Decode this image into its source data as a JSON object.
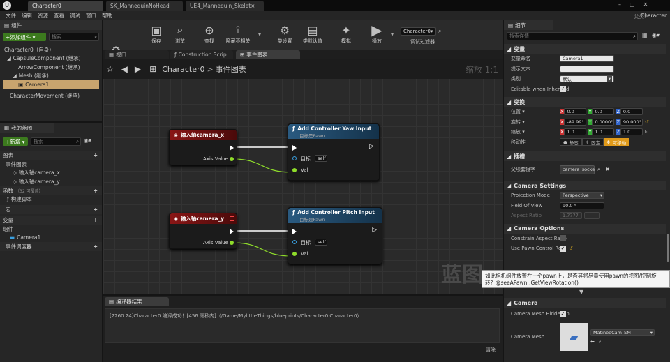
{
  "titlebar": {
    "tabs": [
      "Character0",
      "SK_MannequinNoHead",
      "UE4_Mannequin_Skelet×"
    ],
    "parent_label": "父类:",
    "parent_value": "Character"
  },
  "menu": [
    "文件",
    "编辑",
    "资源",
    "查看",
    "调试",
    "窗口",
    "帮助"
  ],
  "components": {
    "header": "组件",
    "add_button": "+添加组件 ▾",
    "search_placeholder": "搜索",
    "items": [
      "Character0（自身）",
      "CapsuleComponent (继承)",
      "ArrowComponent (继承)",
      "Mesh (继承)",
      "Camera1",
      "CharacterMovement (继承)"
    ]
  },
  "toolbar": {
    "buttons": [
      "编译",
      "保存",
      "浏览",
      "查找",
      "隐藏不相关",
      "类设置",
      "类默认值",
      "模拟",
      "播放"
    ],
    "debug_select": "Character0▾",
    "debug_label": "调试过滤器"
  },
  "graph_tabs": [
    "视口",
    "Construction Scrip",
    "事件图表"
  ],
  "breadcrumb": {
    "root": "Character0",
    "sep": ">",
    "current": "事件图表"
  },
  "zoom": "缩放 1:1",
  "watermark": "蓝图",
  "my_blueprint": {
    "header": "我的蓝图",
    "new_button": "+新增 ▾",
    "search_placeholder": "搜索",
    "sections": {
      "graphs": "图表",
      "event_graph": "事件图表",
      "input_x": "输入轴camera_x",
      "input_y": "输入轴camera_y",
      "functions": "函数",
      "functions_note": "（32 可覆盖）",
      "construct": "构建脚本",
      "macros": "宏",
      "variables": "变量",
      "components": "组件",
      "camera": "Camera1",
      "dispatchers": "事件调度器"
    }
  },
  "nodes": {
    "input_x": {
      "title": "输入轴camera_x",
      "pin": "Axis Value"
    },
    "yaw": {
      "title": "Add Controller Yaw Input",
      "subtitle": "目标是Pawn",
      "target": "目标",
      "self": "self",
      "val": "Val"
    },
    "input_y": {
      "title": "输入轴camera_y",
      "pin": "Axis Value"
    },
    "pitch": {
      "title": "Add Controller Pitch Input",
      "subtitle": "目标是Pawn",
      "target": "目标",
      "self": "self",
      "val": "Val"
    }
  },
  "compiler": {
    "tab": "编译器结果",
    "message": "[2260.24]Character0 编译成功！[456 毫秒内]（/Game/MylittleThings/blueprints/Character0.Character0）",
    "clear": "清除"
  },
  "details": {
    "tab": "细节",
    "search_placeholder": "搜索详情",
    "sections": {
      "variable": "变量",
      "transform": "变换",
      "sockets": "插槽",
      "camera_settings": "Camera Settings",
      "camera_options": "Camera Options",
      "camera": "Camera"
    },
    "var_name_label": "变量命名",
    "var_name": "Camera1",
    "tooltip_label": "提示文本",
    "tooltip": "",
    "category_label": "类别",
    "category": "默认",
    "editable_label": "Editable when Inherited",
    "loc_label": "位置 ▾",
    "loc": [
      "0.0",
      "0.0",
      "0.0"
    ],
    "rot_label": "旋转 ▾",
    "rot": [
      "-89.99°",
      "0.0000°",
      "90.000°"
    ],
    "scale_label": "缩放 ▾",
    "scale": [
      "1.0",
      "1.0",
      "1.0"
    ],
    "mobility_label": "移动性",
    "mobility": [
      "静态",
      "固定",
      "可移动"
    ],
    "parent_socket_label": "父项套接字",
    "parent_socket": "camera_socke",
    "proj_mode_label": "Projection Mode",
    "proj_mode": "Perspective",
    "fov_label": "Field Of View",
    "fov": "90.0 °",
    "aspect_label": "Aspect Ratio",
    "aspect": "1.7777",
    "aspect_extra": "",
    "constrain_label": "Constrain Aspect Ratio",
    "pawn_ctrl_label": "Use Pawn Control Rotat",
    "tooltip_text": "如此相机组件放置在一个pawn上，是否其将尽量使用pawn的视图/控制旋转？@seeAPawn::GetViewRotation()",
    "hidden_label": "Camera Mesh Hidden in",
    "mesh_label": "Camera Mesh",
    "mesh_value": "MatineeCam_SM"
  },
  "colors": {
    "accent_green": "#3c7a1e",
    "node_red": "#7a1414",
    "node_blue": "#1f4a6e",
    "pin_green": "#8fdc2a",
    "selected": "#c8a46e"
  }
}
